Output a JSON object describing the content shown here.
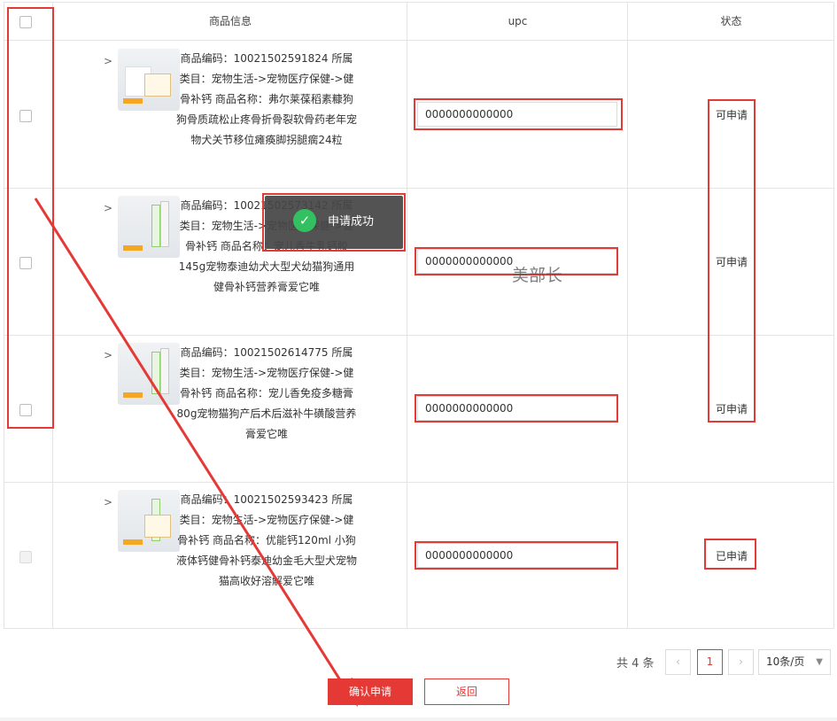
{
  "header": {
    "col_product": "商品信息",
    "col_upc": "upc",
    "col_status": "状态"
  },
  "rows": [
    {
      "info": "商品编码：10021502591824 所属类目：宠物生活->宠物医疗保健->健骨补钙 商品名称：弗尔莱葆稻素糠狗狗骨质疏松止疼骨折骨裂软骨药老年宠物犬关节移位瘫痪脚拐腿瘸24粒",
      "upc": "0000000000000",
      "status": "可申请",
      "selectable": true
    },
    {
      "info": "商品编码：10021502573142 所属类目：宠物生活->宠物医疗保健->健骨补钙 商品名称：宠儿香牛乳钙胶145g宠物泰迪幼犬大型犬幼猫狗通用健骨补钙营养膏爱它唯",
      "upc": "0000000000000",
      "status": "可申请",
      "selectable": true
    },
    {
      "info": "商品编码：10021502614775 所属类目：宠物生活->宠物医疗保健->健骨补钙 商品名称：宠儿香免疫多糖膏80g宠物猫狗产后术后滋补牛磺酸营养膏爱它唯",
      "upc": "0000000000000",
      "status": "可申请",
      "selectable": true
    },
    {
      "info": "商品编码：10021502593423 所属类目：宠物生活->宠物医疗保健->健骨补钙 商品名称：优能钙120ml 小狗液体钙健骨补钙泰迪幼金毛大型犬宠物猫高收好溶解爱它唯",
      "upc": "0000000000000",
      "status": "已申请",
      "selectable": false
    }
  ],
  "toast": {
    "message": "申请成功"
  },
  "watermark": "美部长",
  "pagination": {
    "total": "共 4 条",
    "prev": "‹",
    "current_page": "1",
    "next": "›",
    "page_size": "10条/页"
  },
  "actions": {
    "confirm": "确认申请",
    "back": "返回"
  },
  "colors": {
    "accent": "#e53935",
    "toast_bg": "#464646",
    "success": "#33c060"
  }
}
